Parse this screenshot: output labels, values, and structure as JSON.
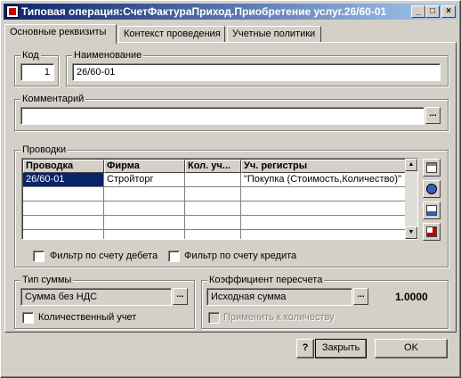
{
  "window": {
    "title": "Типовая операция:СчетФактураПриход.Приобретение услуг.26/60-01",
    "min_label": "_",
    "max_label": "□",
    "close_label": "×"
  },
  "tabs": [
    {
      "label": "Основные реквизиты"
    },
    {
      "label": "Контекст проведения"
    },
    {
      "label": "Учетные политики"
    }
  ],
  "code": {
    "label": "Код",
    "value": "1"
  },
  "name": {
    "label": "Наименование",
    "value": "26/60-01"
  },
  "comment": {
    "label": "Комментарий",
    "value": "",
    "button_label": "..."
  },
  "postings": {
    "label": "Проводки",
    "columns": [
      "Проводка",
      "Фирма",
      "Кол. уч...",
      "Уч. регистры"
    ],
    "rows": [
      [
        "26/60-01",
        "Стройторг",
        "",
        "\"Покупка (Стоимость,Количество)\""
      ]
    ],
    "filter_debit": "Фильтр по счету дебета",
    "filter_credit": "Фильтр по счету кредита"
  },
  "sum_type": {
    "label": "Тип суммы",
    "value": "Сумма без НДС",
    "button_label": "...",
    "quantity_label": "Количественный учет"
  },
  "recalc": {
    "label": "Коэффициент пересчета",
    "value": "Исходная сумма",
    "button_label": "...",
    "coef": "1.0000",
    "apply_label": "Применить к количеству"
  },
  "footer": {
    "help_label": "?",
    "close_label": "Закрыть",
    "ok_label": "OK"
  }
}
